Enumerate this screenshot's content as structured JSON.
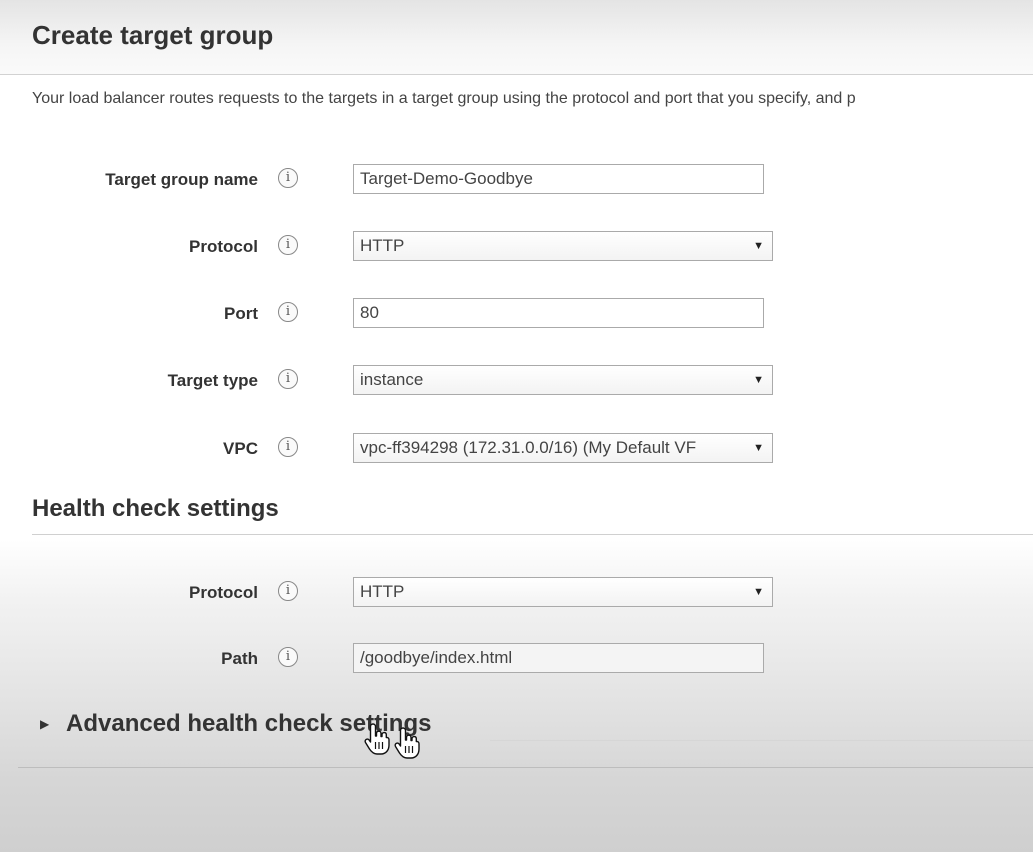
{
  "header": {
    "title": "Create target group"
  },
  "description": "Your load balancer routes requests to the targets in a target group using the protocol and port that you specify, and p",
  "form": {
    "target_group_name": {
      "label": "Target group name",
      "value": "Target-Demo-Goodbye",
      "info_icon": "info-icon"
    },
    "protocol": {
      "label": "Protocol",
      "value": "HTTP"
    },
    "port": {
      "label": "Port",
      "value": "80"
    },
    "target_type": {
      "label": "Target type",
      "value": "instance"
    },
    "vpc": {
      "label": "VPC",
      "value": "vpc-ff394298 (172.31.0.0/16) (My Default VF"
    }
  },
  "health_check": {
    "title": "Health check settings",
    "protocol": {
      "label": "Protocol",
      "value": "HTTP"
    },
    "path": {
      "label": "Path",
      "value": "/goodbye/index.html"
    }
  },
  "advanced": {
    "label": "Advanced health check settings",
    "expanded": false
  },
  "glyphs": {
    "info": "i",
    "caret": "▼",
    "expand": "▶"
  },
  "cursor_icon": "hand-pointer-icon"
}
